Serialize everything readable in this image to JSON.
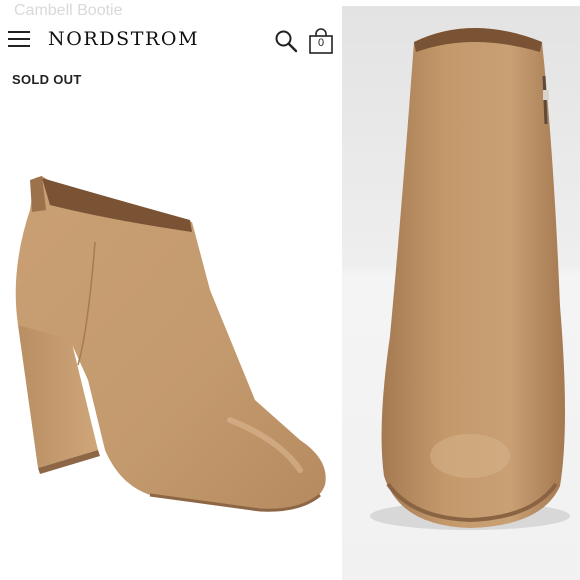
{
  "header": {
    "brand": "NORDSTROM",
    "ghost_title": "Cambell Bootie",
    "bag_count": "0"
  },
  "product": {
    "status": "SOLD OUT"
  },
  "colors": {
    "leather": "#c49a6c",
    "leather_shadow": "#a57a52",
    "lining": "#7a5234",
    "background": "#ffffff"
  },
  "icons": {
    "menu": "hamburger-menu-icon",
    "search": "search-icon",
    "bag": "shopping-bag-icon"
  }
}
